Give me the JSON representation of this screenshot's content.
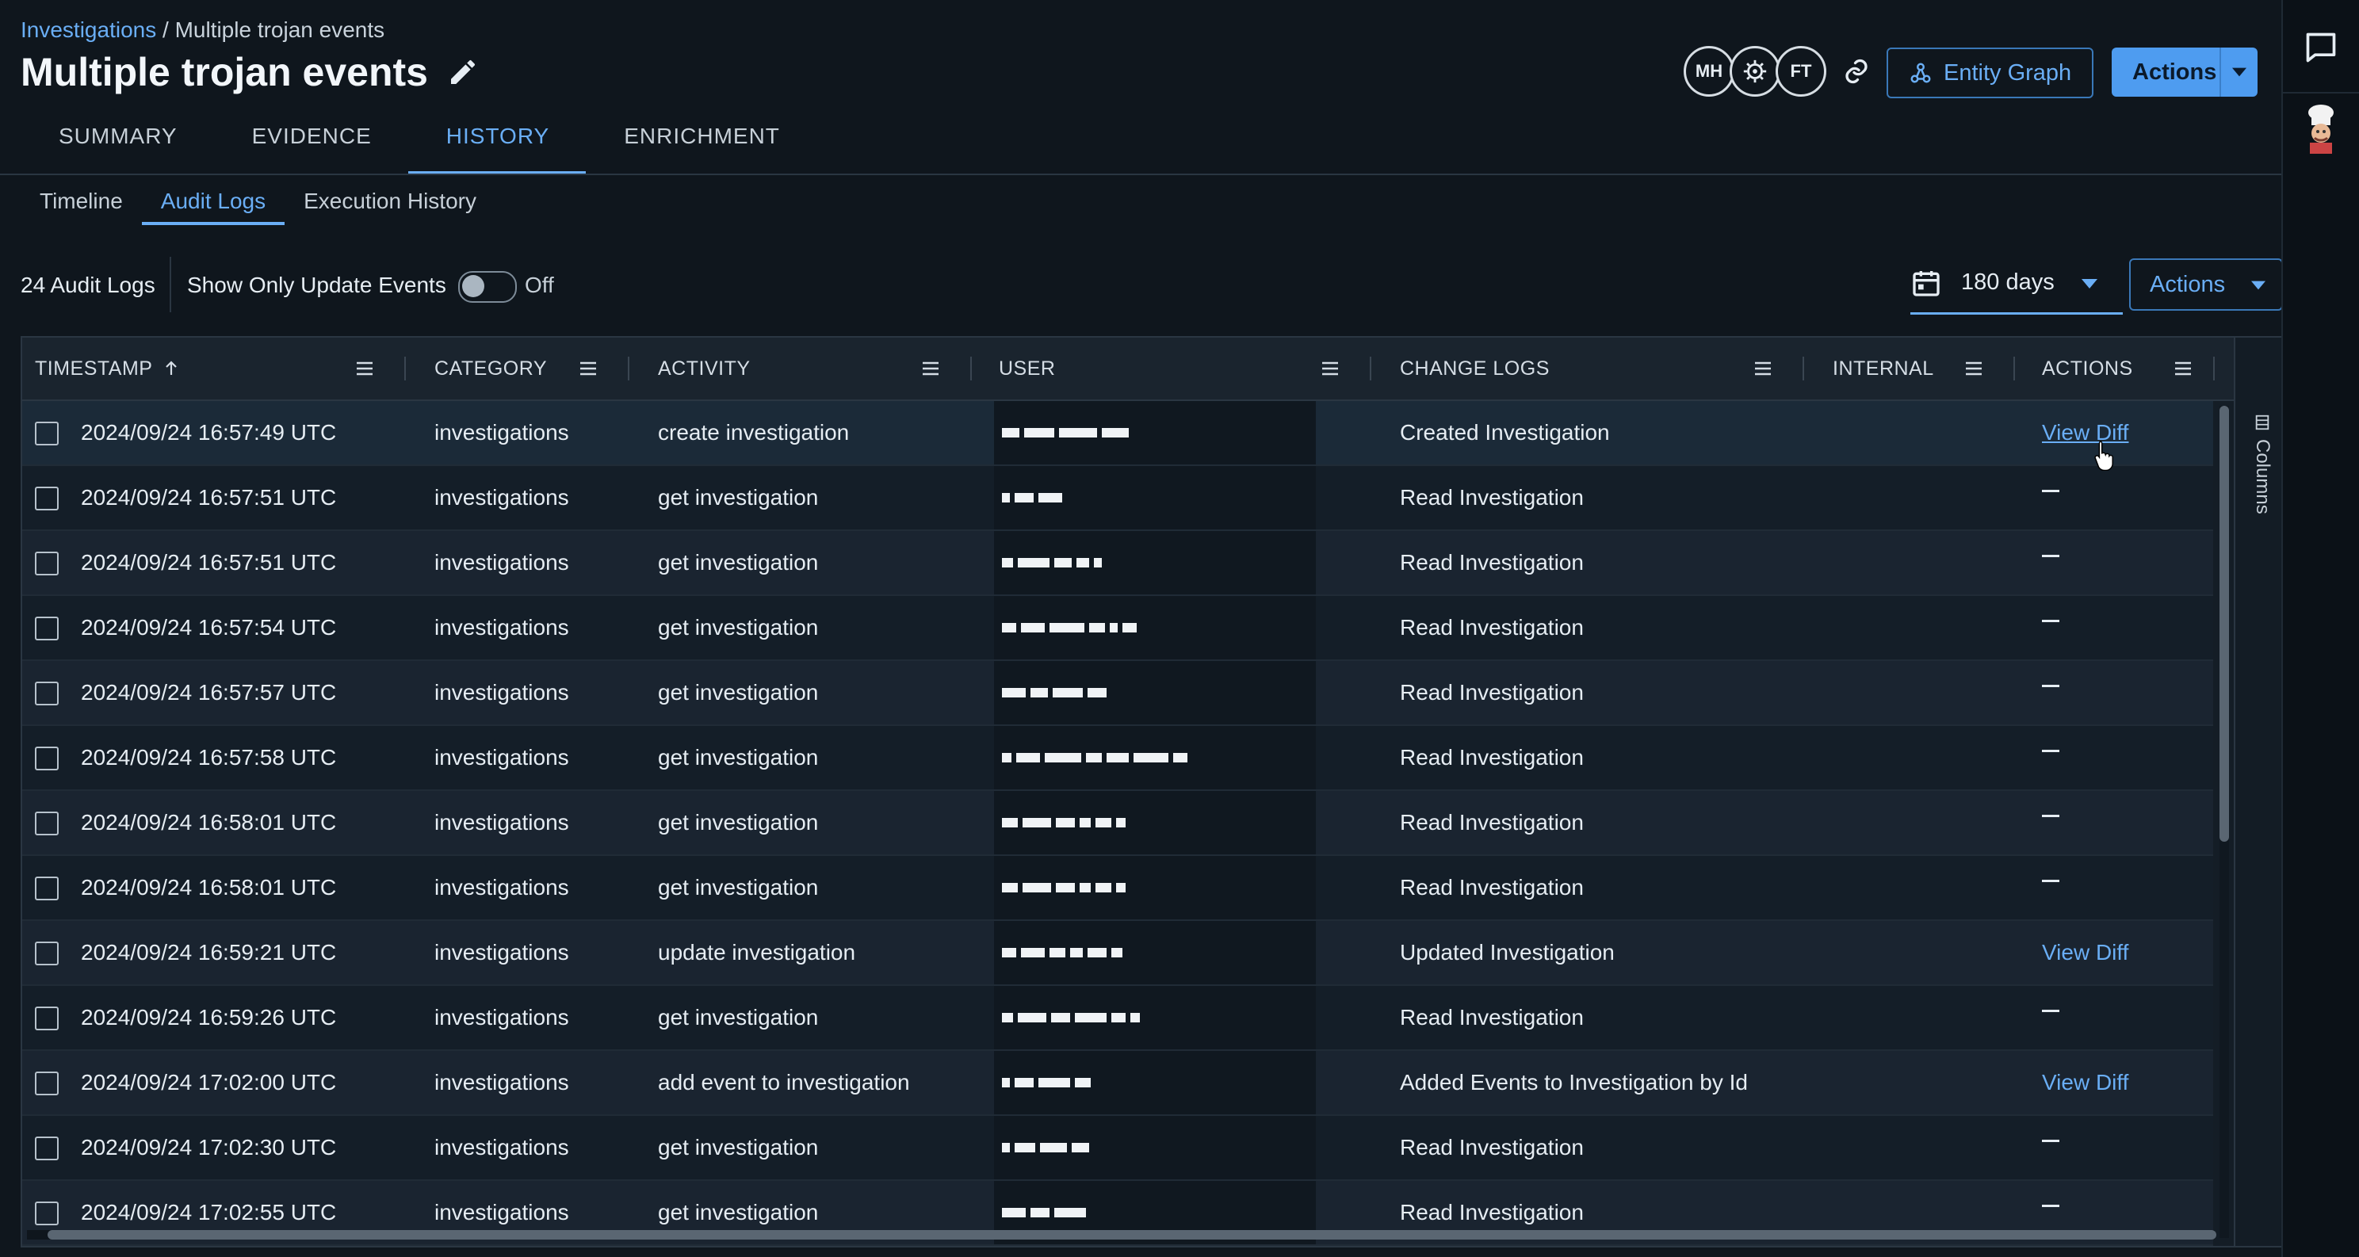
{
  "breadcrumb": {
    "root": "Investigations",
    "sep": " / ",
    "current": "Multiple trojan events"
  },
  "title": "Multiple trojan events",
  "tabs": [
    "SUMMARY",
    "EVIDENCE",
    "HISTORY",
    "ENRICHMENT"
  ],
  "active_tab": "HISTORY",
  "subtabs": [
    "Timeline",
    "Audit Logs",
    "Execution History"
  ],
  "active_subtab": "Audit Logs",
  "avatars": [
    "MH",
    "",
    "FT"
  ],
  "header_buttons": {
    "entity_graph": "Entity Graph",
    "actions": "Actions"
  },
  "toolbar": {
    "count": "24 Audit Logs",
    "toggle_label": "Show Only Update Events",
    "toggle_state": "Off",
    "days": "180 days",
    "actions": "Actions"
  },
  "columns": [
    "TIMESTAMP",
    "CATEGORY",
    "ACTIVITY",
    "USER",
    "CHANGE LOGS",
    "INTERNAL",
    "ACTIONS"
  ],
  "side_panel": {
    "columns_label": "Columns"
  },
  "rows": [
    {
      "timestamp": "2024/09/24 16:57:49 UTC",
      "category": "investigations",
      "activity": "create investigation",
      "changelog": "Created Investigation",
      "action": "View Diff"
    },
    {
      "timestamp": "2024/09/24 16:57:51 UTC",
      "category": "investigations",
      "activity": "get investigation",
      "changelog": "Read Investigation",
      "action": "—"
    },
    {
      "timestamp": "2024/09/24 16:57:51 UTC",
      "category": "investigations",
      "activity": "get investigation",
      "changelog": "Read Investigation",
      "action": "—"
    },
    {
      "timestamp": "2024/09/24 16:57:54 UTC",
      "category": "investigations",
      "activity": "get investigation",
      "changelog": "Read Investigation",
      "action": "—"
    },
    {
      "timestamp": "2024/09/24 16:57:57 UTC",
      "category": "investigations",
      "activity": "get investigation",
      "changelog": "Read Investigation",
      "action": "—"
    },
    {
      "timestamp": "2024/09/24 16:57:58 UTC",
      "category": "investigations",
      "activity": "get investigation",
      "changelog": "Read Investigation",
      "action": "—"
    },
    {
      "timestamp": "2024/09/24 16:58:01 UTC",
      "category": "investigations",
      "activity": "get investigation",
      "changelog": "Read Investigation",
      "action": "—"
    },
    {
      "timestamp": "2024/09/24 16:58:01 UTC",
      "category": "investigations",
      "activity": "get investigation",
      "changelog": "Read Investigation",
      "action": "—"
    },
    {
      "timestamp": "2024/09/24 16:59:21 UTC",
      "category": "investigations",
      "activity": "update investigation",
      "changelog": "Updated Investigation",
      "action": "View Diff"
    },
    {
      "timestamp": "2024/09/24 16:59:26 UTC",
      "category": "investigations",
      "activity": "get investigation",
      "changelog": "Read Investigation",
      "action": "—"
    },
    {
      "timestamp": "2024/09/24 17:02:00 UTC",
      "category": "investigations",
      "activity": "add event to investigation",
      "changelog": "Added Events to Investigation by Id",
      "action": "View Diff"
    },
    {
      "timestamp": "2024/09/24 17:02:30 UTC",
      "category": "investigations",
      "activity": "get investigation",
      "changelog": "Read Investigation",
      "action": "—"
    },
    {
      "timestamp": "2024/09/24 17:02:55 UTC",
      "category": "investigations",
      "activity": "get investigation",
      "changelog": "Read Investigation",
      "action": "—"
    }
  ],
  "colors": {
    "accent": "#6aaef5",
    "background": "#0f161d"
  }
}
